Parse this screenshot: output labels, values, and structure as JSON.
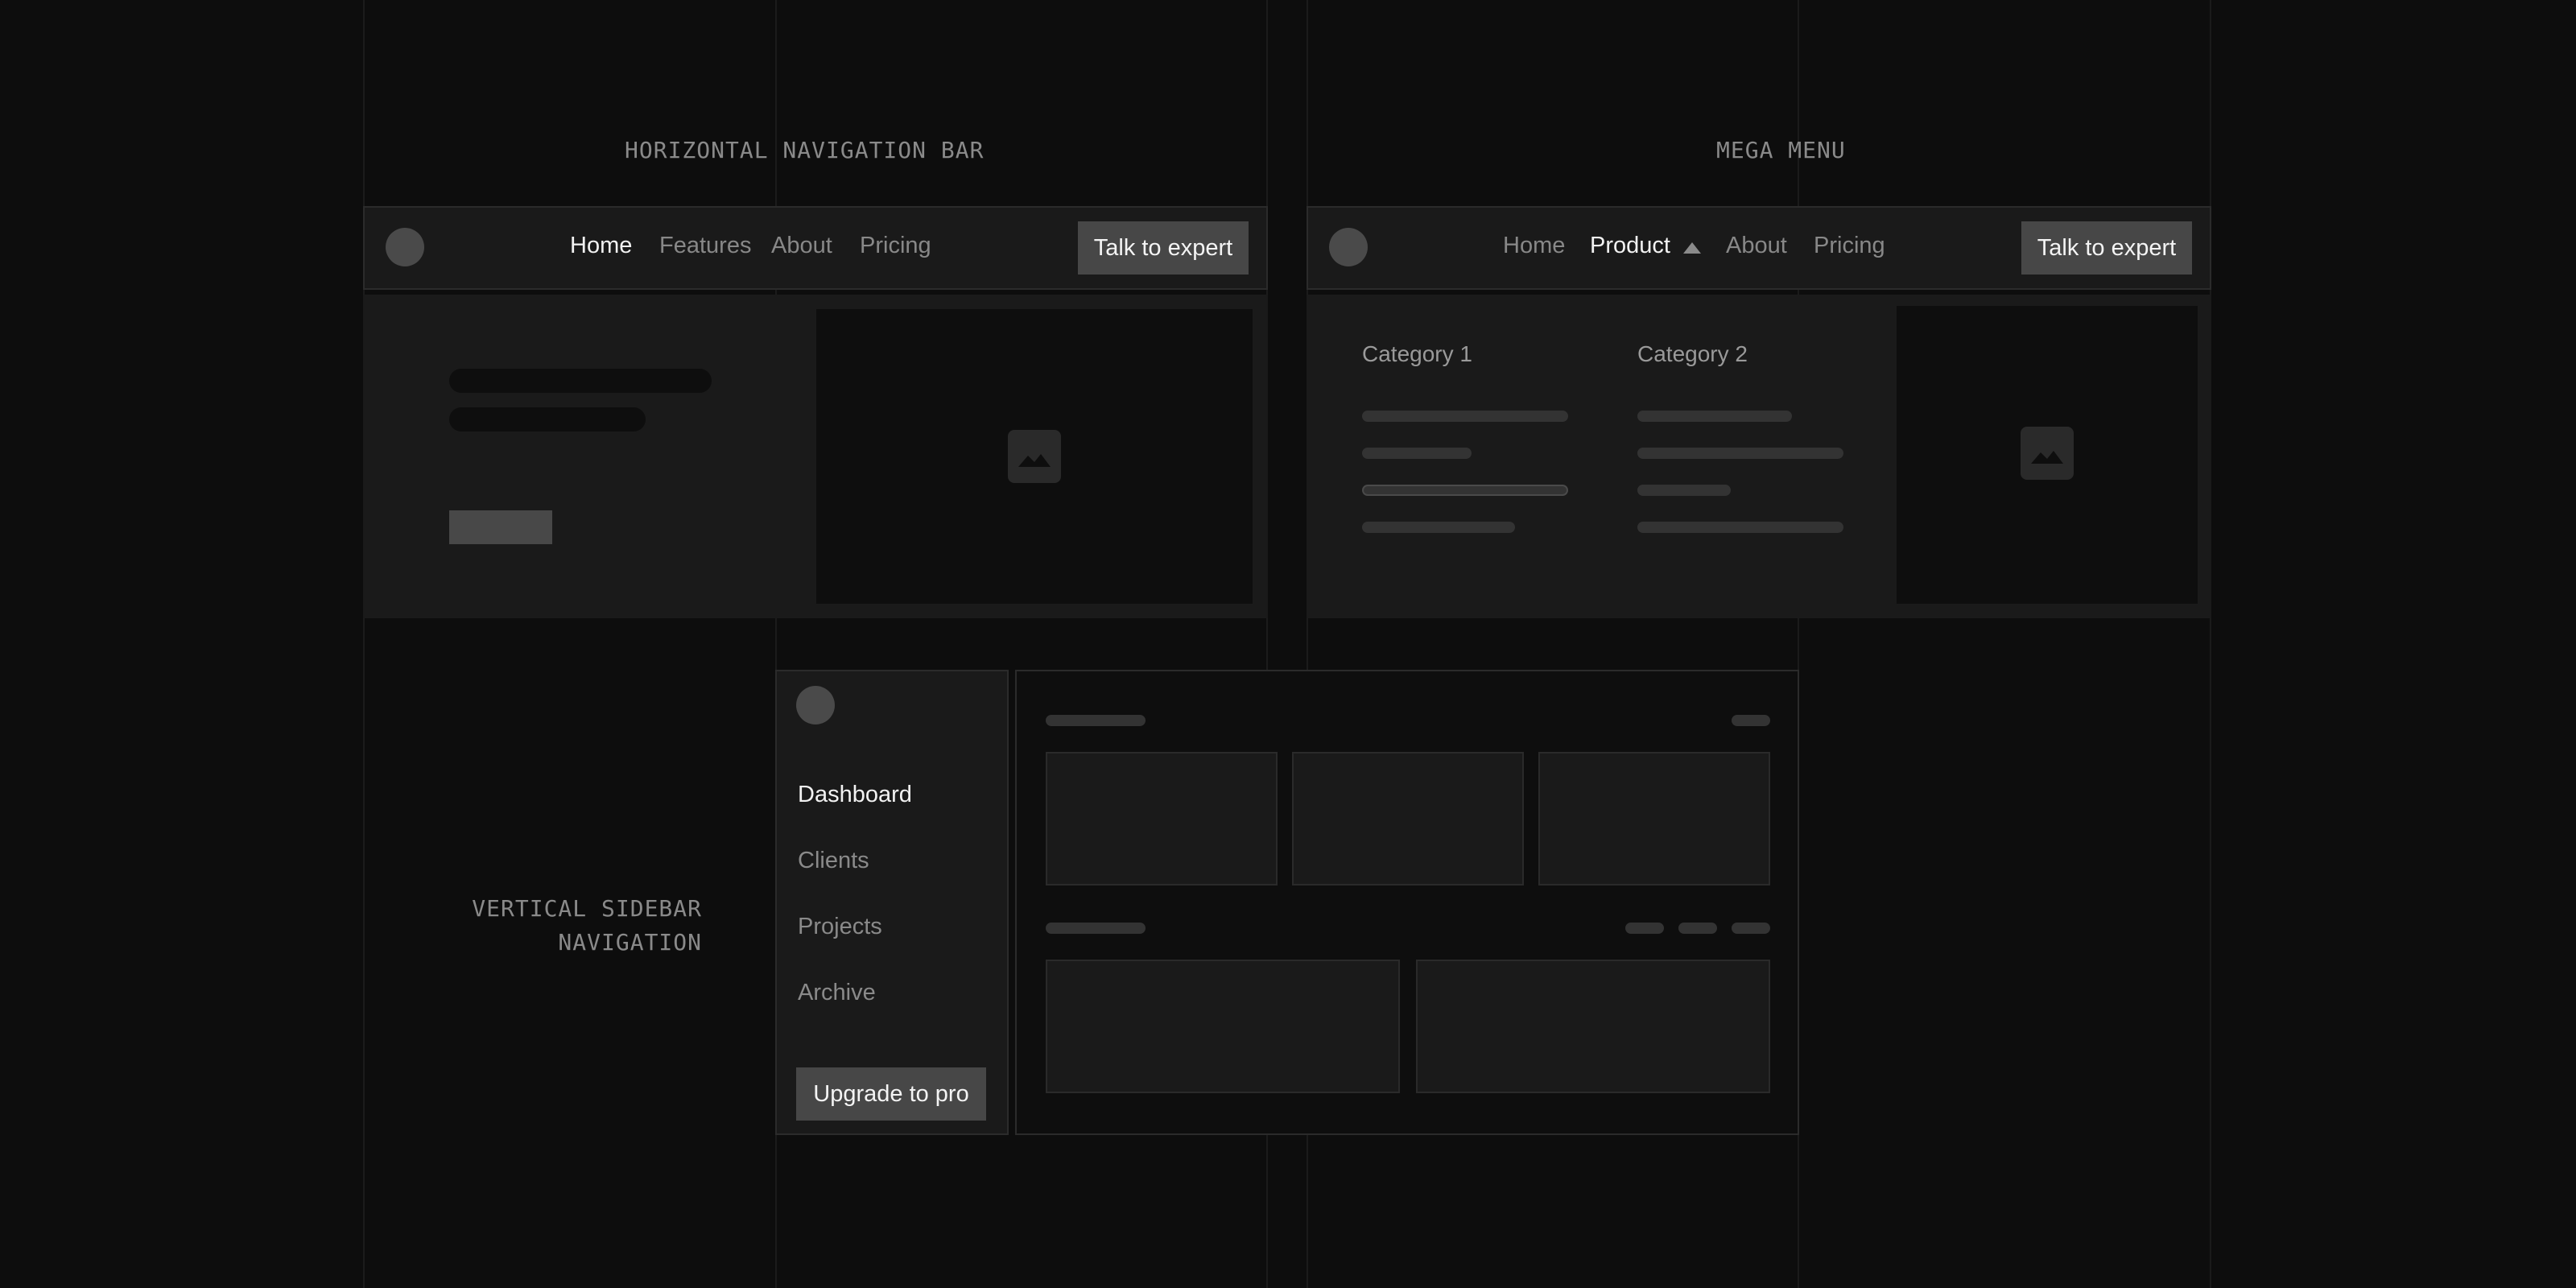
{
  "captions": {
    "horizontal": "HORIZONTAL NAVIGATION BAR",
    "mega": "MEGA MENU",
    "sidebar_line1": "VERTICAL SIDEBAR",
    "sidebar_line2": "NAVIGATION"
  },
  "horizontal_nav": {
    "items": [
      {
        "label": "Home",
        "active": true
      },
      {
        "label": "Features"
      },
      {
        "label": "About"
      },
      {
        "label": "Pricing"
      }
    ],
    "cta_label": "Talk to expert",
    "hero_image_icon": "image-icon"
  },
  "mega_menu": {
    "items": [
      {
        "label": "Home"
      },
      {
        "label": "Product",
        "active": true,
        "expanded": true
      },
      {
        "label": "About"
      },
      {
        "label": "Pricing"
      }
    ],
    "dropdown_icon": "caret-up-icon",
    "cta_label": "Talk to expert",
    "categories": [
      {
        "title": "Category 1"
      },
      {
        "title": "Category 2"
      }
    ],
    "image_icon": "image-icon"
  },
  "sidebar": {
    "items": [
      {
        "label": "Dashboard",
        "active": true
      },
      {
        "label": "Clients"
      },
      {
        "label": "Projects"
      },
      {
        "label": "Archive"
      }
    ],
    "upgrade_label": "Upgrade to pro"
  },
  "colors": {
    "background": "#0d0d0d",
    "panel": "#1a1a1a",
    "button": "#474747",
    "text_active": "#f2f2f2",
    "text_muted": "#888888"
  }
}
